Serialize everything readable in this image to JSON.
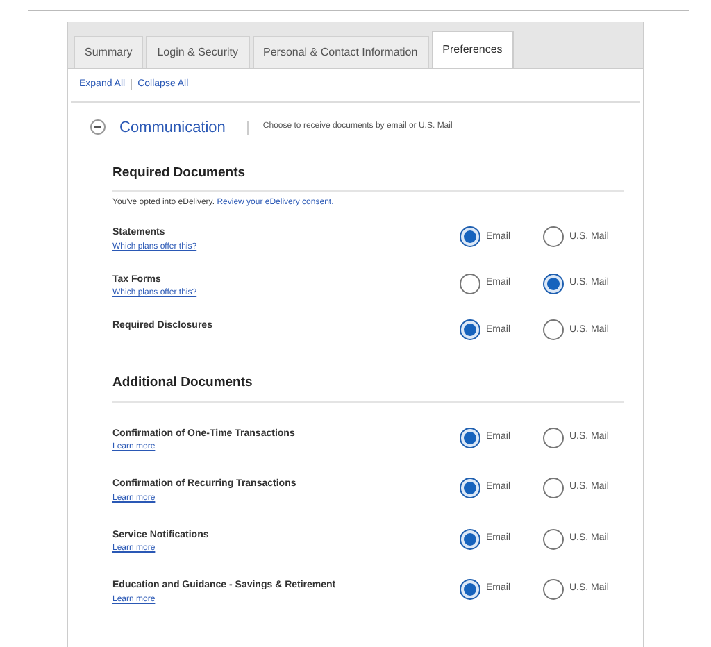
{
  "tabs": [
    {
      "label": "Summary",
      "selected": false
    },
    {
      "label": "Login & Security",
      "selected": false
    },
    {
      "label": "Personal & Contact Information",
      "selected": false
    },
    {
      "label": "Preferences",
      "selected": true
    }
  ],
  "toolbar_links": [
    "Expand All",
    "Collapse All"
  ],
  "section": {
    "title": "Communication",
    "expanded": true,
    "description": "Choose to receive documents by email or U.S. Mail"
  },
  "groups": [
    {
      "title": "Required Documents",
      "note_link": "Review your eDelivery consent.",
      "note_text": "You've opted into eDelivery.",
      "items": [
        {
          "name": "Statements",
          "link": "Which plans offer this?",
          "options": [
            {
              "label": "Email",
              "selected": true
            },
            {
              "label": "U.S. Mail",
              "selected": false
            }
          ]
        },
        {
          "name": "Tax Forms",
          "link": "Which plans offer this?",
          "options": [
            {
              "label": "Email",
              "selected": false
            },
            {
              "label": "U.S. Mail",
              "selected": true
            }
          ]
        },
        {
          "name": "Required Disclosures",
          "options": [
            {
              "label": "Email",
              "selected": true
            },
            {
              "label": "U.S. Mail",
              "selected": false
            }
          ]
        }
      ]
    },
    {
      "title": "Additional Documents",
      "items": [
        {
          "name": "Confirmation of One-Time Transactions",
          "link": "Learn more",
          "options": [
            {
              "label": "Email",
              "selected": true
            },
            {
              "label": "U.S. Mail",
              "selected": false
            }
          ]
        },
        {
          "name": "Confirmation of Recurring Transactions",
          "link": "Learn more",
          "options": [
            {
              "label": "Email",
              "selected": true
            },
            {
              "label": "U.S. Mail",
              "selected": false
            }
          ]
        },
        {
          "name": "Service Notifications",
          "link": "Learn more",
          "options": [
            {
              "label": "Email",
              "selected": true
            },
            {
              "label": "U.S. Mail",
              "selected": false
            }
          ]
        },
        {
          "name": "Education and Guidance - Savings & Retirement",
          "link": "Learn more",
          "options": [
            {
              "label": "Email",
              "selected": true
            },
            {
              "label": "U.S. Mail",
              "selected": false
            }
          ]
        }
      ]
    }
  ]
}
